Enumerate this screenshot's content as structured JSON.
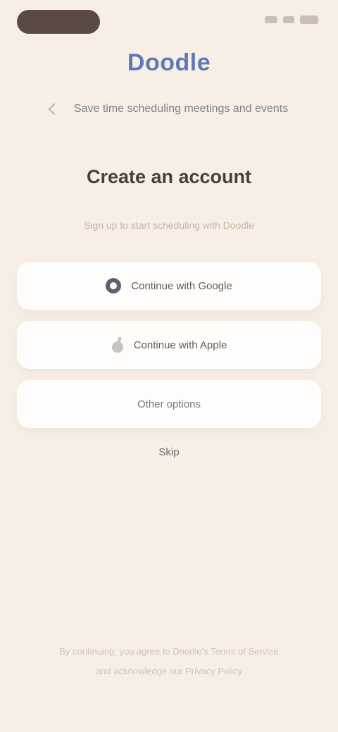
{
  "status_bar": {
    "icons": [
      "signal-icon",
      "wifi-icon",
      "battery-icon"
    ]
  },
  "app": {
    "logo_text": "Doodle"
  },
  "header": {
    "tagline": "Save time scheduling meetings and events"
  },
  "onboarding": {
    "headline": "Create an account",
    "subtext": "Sign up to start scheduling with Doodle",
    "buttons": {
      "google": "Continue with Google",
      "apple": "Continue with Apple",
      "other": "Other options"
    },
    "skip_label": "Skip"
  },
  "footer": {
    "line1": "By continuing, you agree to Doodle's Terms of Service",
    "line2": "and acknowledge our Privacy Policy"
  },
  "colors": {
    "background": "#f7efe6",
    "brand_blue": "#5f79b8",
    "button_bg": "#fffdfb"
  }
}
